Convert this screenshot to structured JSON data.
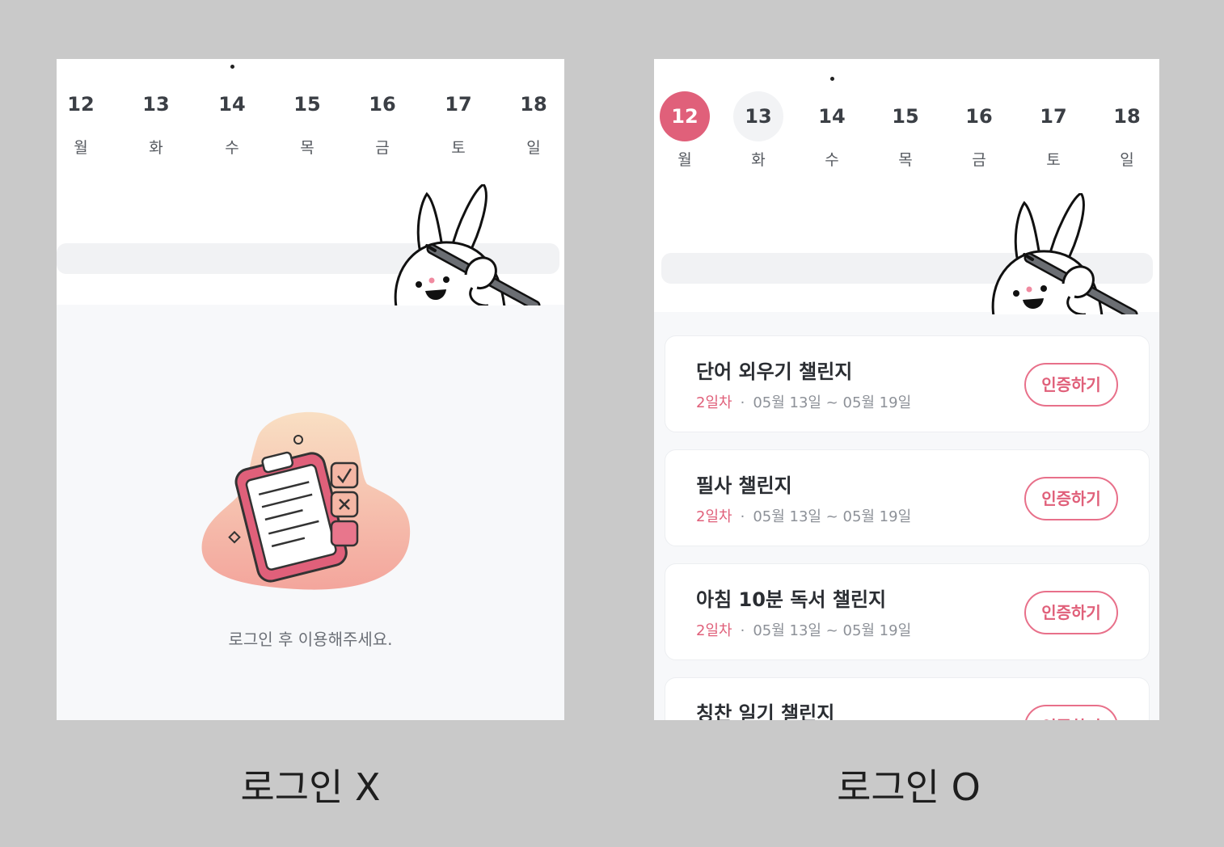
{
  "left_panel": {
    "days": [
      {
        "num": "12",
        "label": "월"
      },
      {
        "num": "13",
        "label": "화"
      },
      {
        "num": "14",
        "label": "수"
      },
      {
        "num": "15",
        "label": "목"
      },
      {
        "num": "16",
        "label": "금"
      },
      {
        "num": "17",
        "label": "토"
      },
      {
        "num": "18",
        "label": "일"
      }
    ],
    "empty_message": "로그인 후 이용해주세요.",
    "caption": "로그인 X"
  },
  "right_panel": {
    "days": [
      {
        "num": "12",
        "label": "월"
      },
      {
        "num": "13",
        "label": "화"
      },
      {
        "num": "14",
        "label": "수"
      },
      {
        "num": "15",
        "label": "목"
      },
      {
        "num": "16",
        "label": "금"
      },
      {
        "num": "17",
        "label": "토"
      },
      {
        "num": "18",
        "label": "일"
      }
    ],
    "challenges": [
      {
        "title": "단어 외우기 챌린지",
        "day": "2일차",
        "period": "05월 13일 ~ 05월 19일",
        "button": "인증하기"
      },
      {
        "title": "필사 챌린지",
        "day": "2일차",
        "period": "05월 13일 ~ 05월 19일",
        "button": "인증하기"
      },
      {
        "title": "아침 10분 독서 챌린지",
        "day": "2일차",
        "period": "05월 13일 ~ 05월 19일",
        "button": "인증하기"
      },
      {
        "title": "칭찬 일기 챌린지",
        "day": "",
        "period": "",
        "button": "인증하기"
      }
    ],
    "caption": "로그인 O"
  },
  "colors": {
    "accent": "#e0607a",
    "background": "#c9c9c9",
    "panel": "#f7f8fa"
  }
}
